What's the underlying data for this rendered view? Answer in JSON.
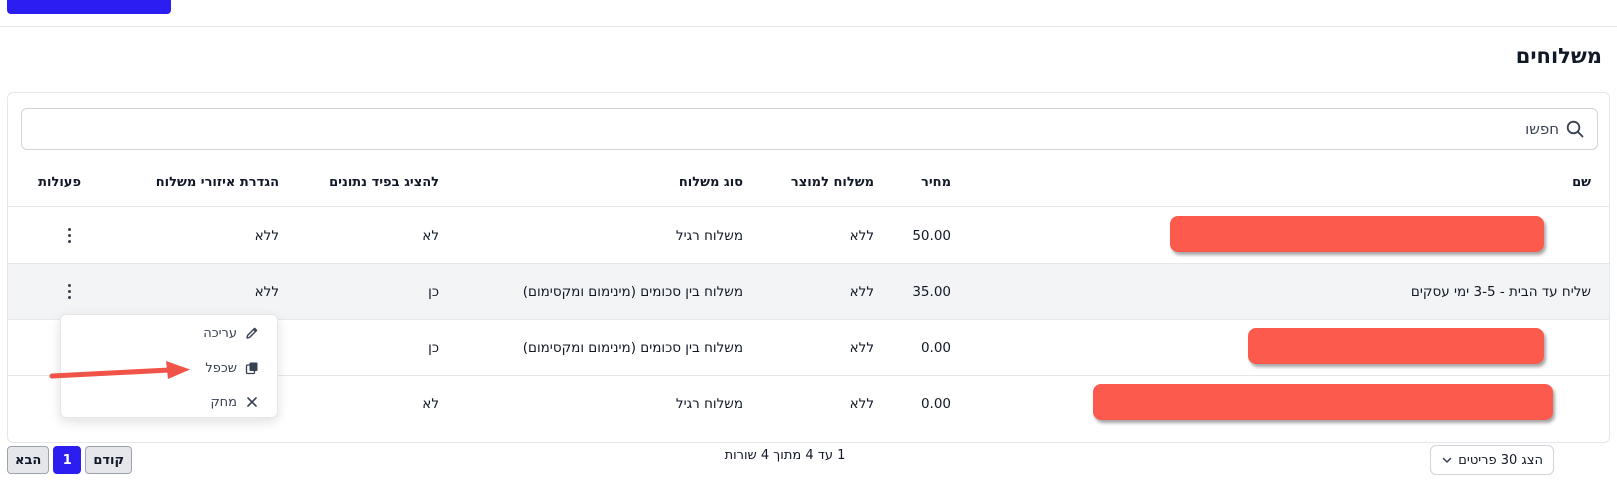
{
  "page": {
    "title": "משלוחים"
  },
  "search": {
    "placeholder": "חפשו"
  },
  "table": {
    "headers": {
      "name": "שם",
      "price": "מחיר",
      "product_shipping": "משלוח למוצר",
      "shipping_type": "סוג משלוח",
      "show_in_feed": "להציג בפיד נתונים",
      "region_settings": "הגדרת איזורי משלוח",
      "actions": "פעולות"
    },
    "rows": [
      {
        "name": "",
        "price": "50.00",
        "product_shipping": "ללא",
        "shipping_type": "משלוח רגיל",
        "show_in_feed": "לא",
        "region_settings": "ללא"
      },
      {
        "name": "שליח עד הבית - 3-5 ימי עסקים",
        "price": "35.00",
        "product_shipping": "ללא",
        "shipping_type": "משלוח בין סכומים (מינימום ומקסימום)",
        "show_in_feed": "כן",
        "region_settings": "ללא"
      },
      {
        "name": "",
        "price": "0.00",
        "product_shipping": "ללא",
        "shipping_type": "משלוח בין סכומים (מינימום ומקסימום)",
        "show_in_feed": "כן",
        "region_settings": ""
      },
      {
        "name": "",
        "price": "0.00",
        "product_shipping": "ללא",
        "shipping_type": "משלוח רגיל",
        "show_in_feed": "לא",
        "region_settings": ""
      }
    ]
  },
  "actions_menu": {
    "edit": "עריכה",
    "duplicate": "שכפל",
    "delete": "מחק"
  },
  "pagination": {
    "prev": "קודם",
    "current": "1",
    "next": "הבא",
    "summary": "1 עד 4 מתוך 4 שורות",
    "page_size": "הצג 30 פריטים"
  },
  "colors": {
    "accent": "#2c1ef0",
    "redaction": "#fc5a4d"
  }
}
